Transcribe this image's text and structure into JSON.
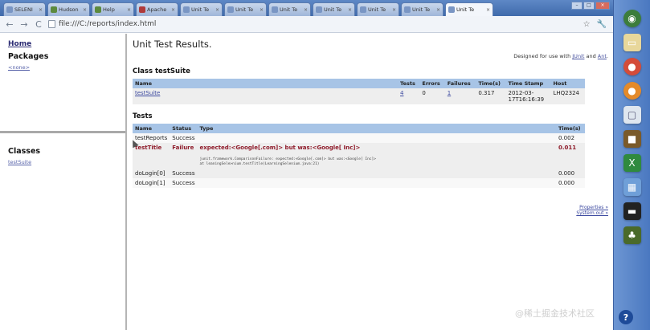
{
  "browser": {
    "tabs": [
      {
        "label": "SELENI"
      },
      {
        "label": "Hudson"
      },
      {
        "label": "Help"
      },
      {
        "label": "Apache"
      },
      {
        "label": "Unit Te"
      },
      {
        "label": "Unit Te"
      },
      {
        "label": "Unit Te"
      },
      {
        "label": "Unit Te"
      },
      {
        "label": "Unit Te"
      },
      {
        "label": "Unit Te"
      },
      {
        "label": "Unit Te"
      },
      {
        "label": "Unit Te"
      }
    ],
    "address": "file:///C:/reports/index.html",
    "star_glyph": "☆",
    "wrench_glyph": "🔧"
  },
  "left_frame": {
    "home": "Home",
    "packages_heading": "Packages",
    "package_link": "<none>",
    "classes_heading": "Classes",
    "class_link": "testSuite"
  },
  "main": {
    "title": "Unit Test Results.",
    "designed_prefix": "Designed for use with ",
    "junit_link": "JUnit",
    "and_text": " and ",
    "ant_link": "Ant",
    "designed_suffix": ".",
    "class_heading": "Class testSuite",
    "class_table": {
      "headers": [
        "Name",
        "Tests",
        "Errors",
        "Failures",
        "Time(s)",
        "Time Stamp",
        "Host"
      ],
      "row": {
        "name": "testSuite",
        "tests": "4",
        "errors": "0",
        "failures": "1",
        "time": "0.317",
        "timestamp": "2012-03-17T16:16:39",
        "host": "LHQ2324"
      }
    },
    "tests_heading": "Tests",
    "tests_table": {
      "headers": [
        "Name",
        "Status",
        "Type",
        "Time(s)"
      ],
      "rows": [
        {
          "name": "testReports",
          "status": "Success",
          "type": "",
          "time": "0.002"
        },
        {
          "name": "testTitle",
          "status": "Failure",
          "type": "expected:<Google[.com]> but was:<Google[ Inc]>",
          "trace1": "junit.framework.ComparisonFailure: expected:<Google[.com]> but was:<Google[ Inc]>",
          "trace2": "at leaningSele>nium.testTitle(LearningSelenium.java:21)",
          "time": "0.011"
        },
        {
          "name": "doLogin[0]",
          "status": "Success",
          "type": "",
          "time": "0.000"
        },
        {
          "name": "doLogin[1]",
          "status": "Success",
          "type": "",
          "time": "0.000"
        }
      ]
    },
    "properties_link": "Properties »",
    "sysout_link": "System.out »"
  },
  "watermark": "@稀土掘金技术社区",
  "help_glyph": "?"
}
